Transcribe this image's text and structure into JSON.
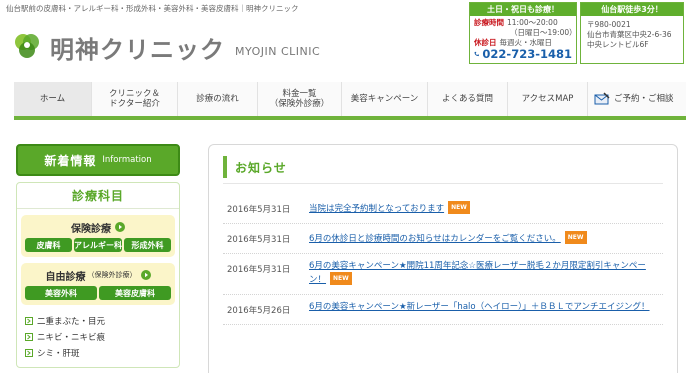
{
  "header": {
    "tagline": "仙台駅前の皮膚科・アレルギー科・形成外科・美容外科・美容皮膚科｜明神クリニック",
    "logo_name": "明神クリニック",
    "logo_en": "MYOJIN CLINIC",
    "hours": {
      "heading": "土日・祝日も診療！",
      "hours_label": "診療時間",
      "hours_value": "11:00～20:00",
      "hours_sub": "（日曜日～19:00）",
      "closed_label": "休診日",
      "closed_value": "毎週火・水曜日",
      "phone": "022-723-1481"
    },
    "access": {
      "heading": "仙台駅徒歩3分！",
      "postal": "〒980-0021",
      "address1": "仙台市青葉区中央2-6-36",
      "address2": "中央レントビル6F"
    }
  },
  "nav": {
    "items": [
      {
        "label": "ホーム"
      },
      {
        "label": "クリニック＆",
        "label2": "ドクター紹介"
      },
      {
        "label": "診療の流れ"
      },
      {
        "label": "料金一覧",
        "label2": "（保険外診療）"
      },
      {
        "label": "美容キャンペーン"
      },
      {
        "label": "よくある質問"
      },
      {
        "label": "アクセスMAP"
      },
      {
        "label": "ご予約・ご相談"
      }
    ]
  },
  "sidebar": {
    "news_button": {
      "jp": "新着情報",
      "en": "Information"
    },
    "dept_title": "診療科目",
    "insurance": {
      "title": "保険診療",
      "pills": [
        "皮膚科",
        "アレルギー科",
        "形成外科"
      ]
    },
    "private": {
      "title": "自由診療",
      "title_small": "（保険外診療）",
      "pills": [
        "美容外科",
        "美容皮膚科"
      ]
    },
    "links": [
      "二重まぶた・目元",
      "ニキビ・ニキビ痕",
      "シミ・肝斑"
    ]
  },
  "main": {
    "title": "お知らせ",
    "new_badge": "NEW",
    "news": [
      {
        "date": "2016年5月31日",
        "text": "当院は完全予約制となっております",
        "new": true
      },
      {
        "date": "2016年5月31日",
        "text": "6月の休診日と診療時間のお知らせはカレンダーをご覧ください。",
        "new": true
      },
      {
        "date": "2016年5月31日",
        "text": "6月の美容キャンペーン★開院11周年記念☆医療レーザー脱毛２か月限定割引キャンペーン！",
        "new": true
      },
      {
        "date": "2016年5月26日",
        "text": "6月の美容キャンペーン★新レーザー「halo（ヘイロー）」＋ＢＢＬでアンチエイジング！",
        "new": false
      }
    ]
  },
  "colors": {
    "brand_green": "#5aa829",
    "link_blue": "#1a5faa",
    "new_orange": "#f08a1c",
    "alert_red": "#c8161d"
  }
}
